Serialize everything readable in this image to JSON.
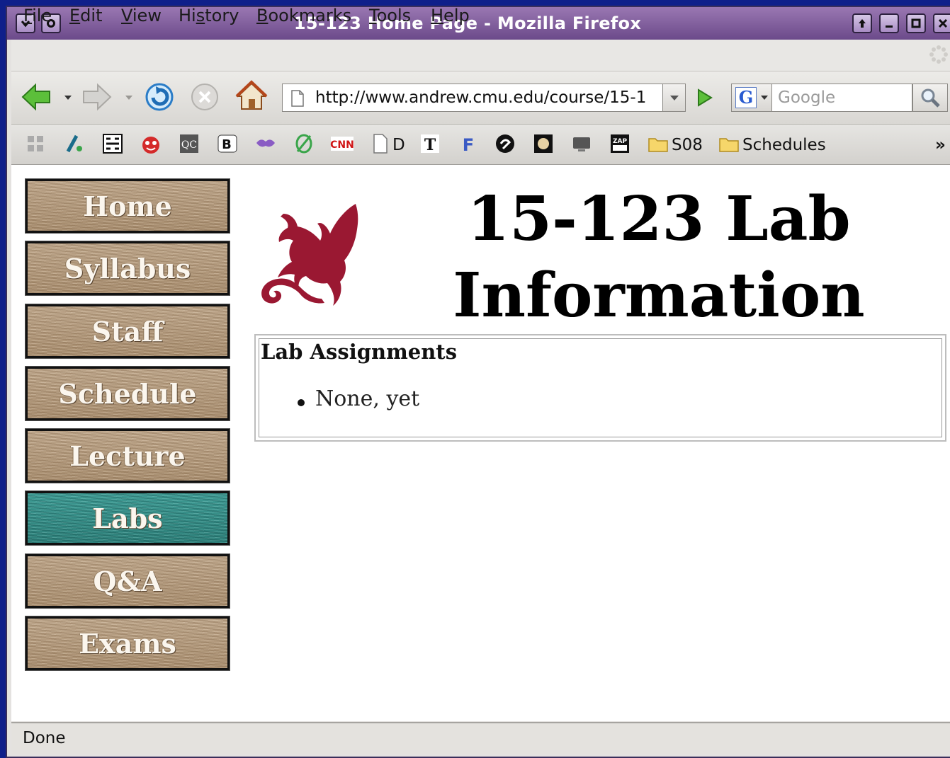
{
  "window": {
    "title": "15-123 Home Page - Mozilla Firefox"
  },
  "menubar": {
    "items": [
      {
        "label": "File",
        "accel": "F",
        "rest": "ile"
      },
      {
        "label": "Edit",
        "accel": "E",
        "rest": "dit"
      },
      {
        "label": "View",
        "accel": "V",
        "rest": "iew"
      },
      {
        "label": "History",
        "pre": "Hi",
        "accel": "s",
        "rest": "tory"
      },
      {
        "label": "Bookmarks",
        "accel": "B",
        "rest": "ookmarks"
      },
      {
        "label": "Tools",
        "accel": "T",
        "rest": "ools"
      },
      {
        "label": "Help",
        "accel": "H",
        "rest": "elp"
      }
    ]
  },
  "navbar": {
    "url": "http://www.andrew.cmu.edu/course/15-1",
    "search_placeholder": "Google"
  },
  "bookmarks": {
    "items": [
      {
        "label": "D"
      },
      {
        "label": "S08"
      },
      {
        "label": "Schedules"
      }
    ],
    "overflow": "»"
  },
  "sidebar": {
    "items": [
      {
        "label": "Home",
        "active": false
      },
      {
        "label": "Syllabus",
        "active": false
      },
      {
        "label": "Staff",
        "active": false
      },
      {
        "label": "Schedule",
        "active": false
      },
      {
        "label": "Lecture",
        "active": false
      },
      {
        "label": "Labs",
        "active": true
      },
      {
        "label": "Q&A",
        "active": false
      },
      {
        "label": "Exams",
        "active": false
      }
    ]
  },
  "main": {
    "heading_line1": "15-123 Lab",
    "heading_line2": "Information",
    "lab_box": {
      "title": "Lab Assignments",
      "items": [
        "None, yet"
      ]
    }
  },
  "status": {
    "text": "Done"
  },
  "colors": {
    "griffin": "#9a1832",
    "active_tile": "#2d7f79",
    "titlebar": "#7d5c9c"
  }
}
